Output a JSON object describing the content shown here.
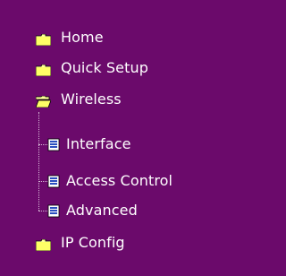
{
  "nav": {
    "items": [
      {
        "label": "Home"
      },
      {
        "label": "Quick Setup"
      },
      {
        "label": "Wireless"
      },
      {
        "label": "Interface"
      },
      {
        "label": "Access Control"
      },
      {
        "label": "Advanced"
      },
      {
        "label": "IP Config"
      }
    ]
  },
  "colors": {
    "background": "#6b0a6b",
    "text": "#ffffff",
    "folder": "#ffff99",
    "folder_shadow": "#b8b800",
    "doc": "#2a4fbf"
  },
  "icons": {
    "closed_folder": "folder-icon",
    "open_folder": "folder-open-icon",
    "page": "document-icon"
  }
}
